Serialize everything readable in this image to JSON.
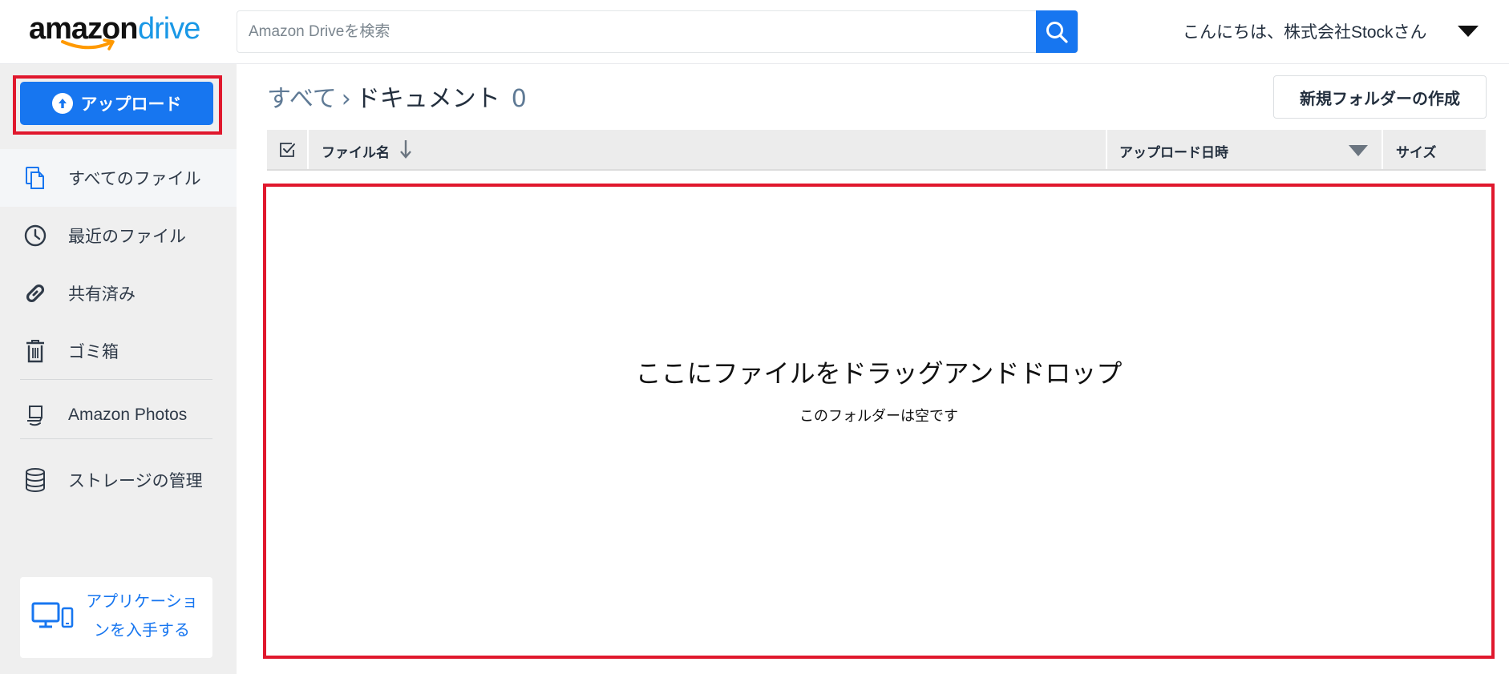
{
  "header": {
    "logo_word1": "amazon",
    "logo_word2": "drive",
    "search_placeholder": "Amazon Driveを検索",
    "greeting": "こんにちは、株式会社Stockさん"
  },
  "sidebar": {
    "upload_label": "アップロード",
    "items": [
      {
        "label": "すべてのファイル",
        "icon": "files-icon",
        "active": true
      },
      {
        "label": "最近のファイル",
        "icon": "clock-icon"
      },
      {
        "label": "共有済み",
        "icon": "link-icon"
      },
      {
        "label": "ゴミ箱",
        "icon": "trash-icon"
      },
      {
        "label": "Amazon Photos",
        "icon": "photos-icon"
      },
      {
        "label": "ストレージの管理",
        "icon": "database-icon"
      }
    ],
    "app_card_label_line1": "アプリケーショ",
    "app_card_label_line2": "ンを入手する"
  },
  "main": {
    "breadcrumb": {
      "root": "すべて",
      "separator": "›",
      "current": "ドキュメント",
      "count": "0"
    },
    "new_folder_label": "新規フォルダーの作成",
    "table": {
      "columns": {
        "name": "ファイル名",
        "date": "アップロード日時",
        "size": "サイズ"
      }
    },
    "drop_zone": {
      "title": "ここにファイルをドラッグアンドドロップ",
      "subtitle": "このフォルダーは空です"
    }
  },
  "colors": {
    "accent": "#1776f0",
    "highlight": "#e0182d",
    "logo_drive": "#1a98e6",
    "logo_smile": "#ff9900"
  }
}
